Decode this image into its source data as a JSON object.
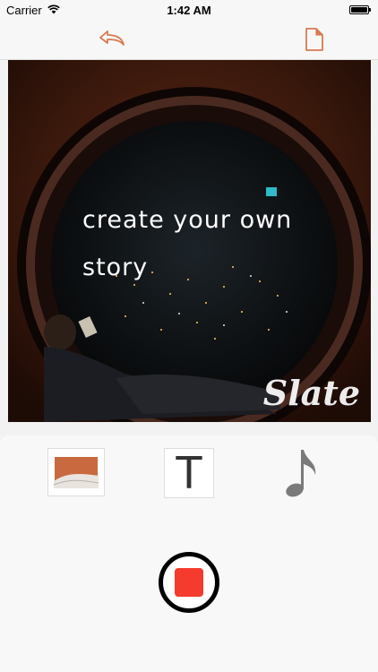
{
  "status_bar": {
    "carrier": "Carrier",
    "time": "1:42 AM"
  },
  "toolbar": {
    "undo_icon": "undo-arrow-icon",
    "page_icon": "new-page-icon"
  },
  "canvas": {
    "story_line1": "create your own",
    "story_line2": "story",
    "watermark": "Slate"
  },
  "tools": {
    "image_icon": "image-icon",
    "text_icon_label": "T",
    "music_icon": "music-note-icon"
  },
  "recorder": {
    "icon": "stop-record-icon",
    "color": "#f43b2e"
  },
  "colors": {
    "accent": "#d97b4f",
    "panel": "#f8f8f8"
  }
}
